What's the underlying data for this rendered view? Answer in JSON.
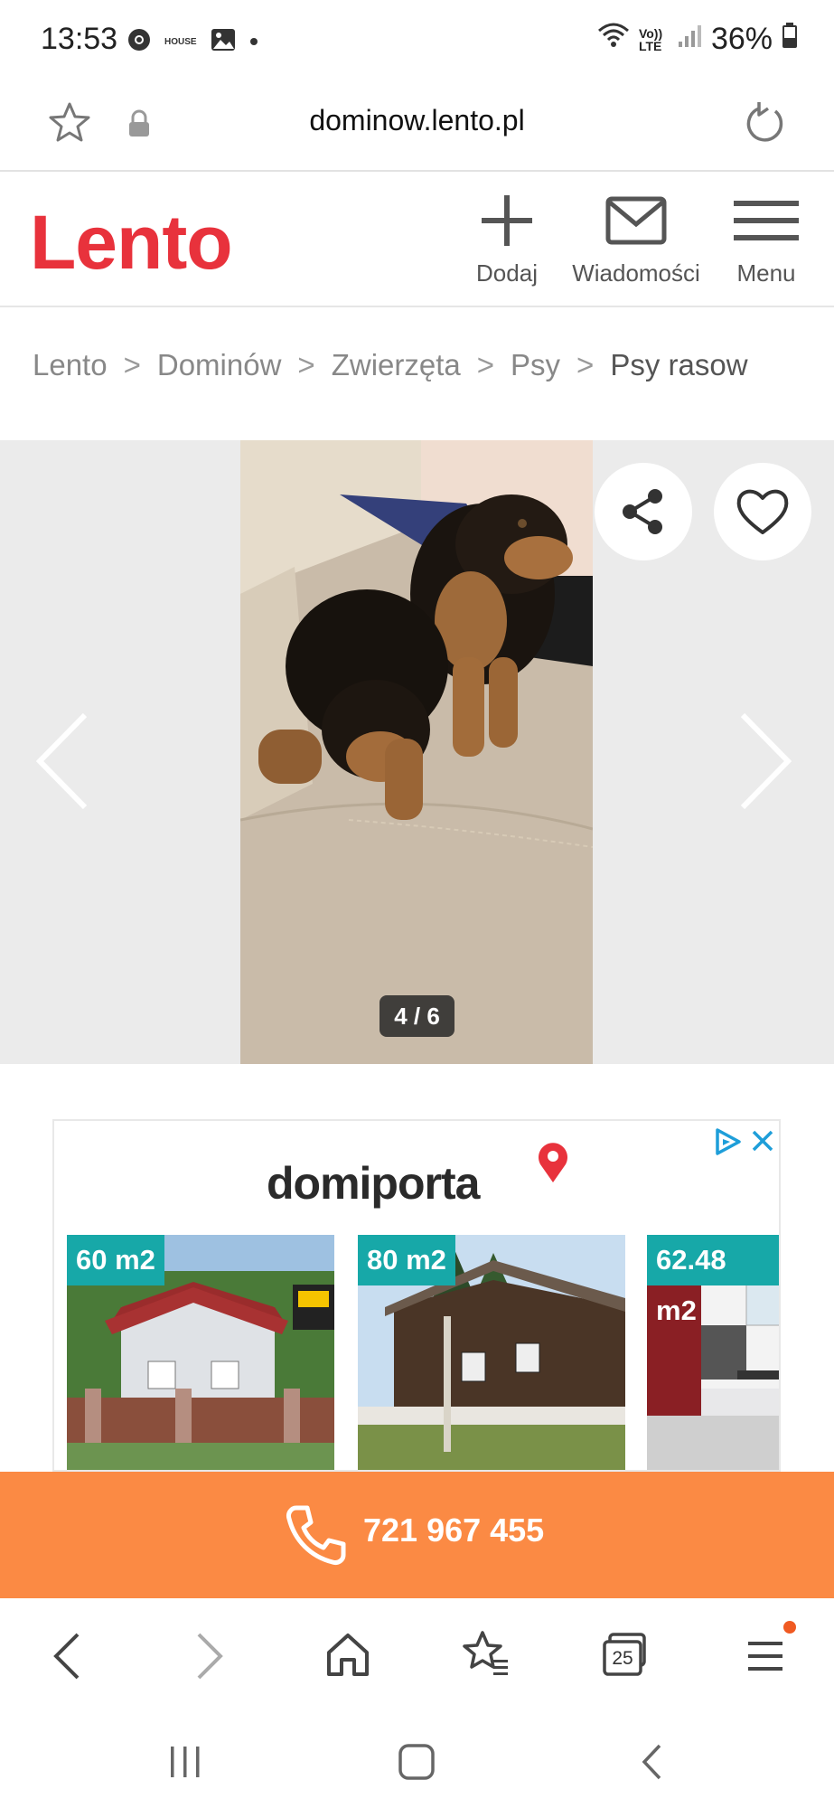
{
  "status_bar": {
    "time": "13:53",
    "house_label": "HOUSE",
    "lte_label": "Vo)) LTE",
    "battery": "36%"
  },
  "url_bar": {
    "url": "dominow.lento.pl"
  },
  "header": {
    "logo": "Lento",
    "nav": [
      {
        "label": "Dodaj",
        "icon": "plus-icon"
      },
      {
        "label": "Wiadomości",
        "icon": "envelope-icon"
      },
      {
        "label": "Menu",
        "icon": "hamburger-icon"
      }
    ]
  },
  "breadcrumb": [
    "Lento",
    "Dominów",
    "Zwierzęta",
    "Psy",
    "Psy rasow"
  ],
  "gallery": {
    "counter": "4 / 6",
    "image_alt": "Two black and tan puppies on a beige sofa"
  },
  "ad": {
    "brand": "domiporta",
    "cards": [
      {
        "area": "60 m2"
      },
      {
        "area": "80 m2"
      },
      {
        "area": "62.48 m2"
      }
    ],
    "colors": {
      "badge": "#17a8a8",
      "pin": "#e8323c"
    }
  },
  "call": {
    "phone": "721 967 455"
  },
  "browser_nav": {
    "tabs_count": "25"
  },
  "colors": {
    "brand_red": "#e8323c",
    "call_orange": "#fb8a44",
    "notification_dot": "#f05a22"
  }
}
